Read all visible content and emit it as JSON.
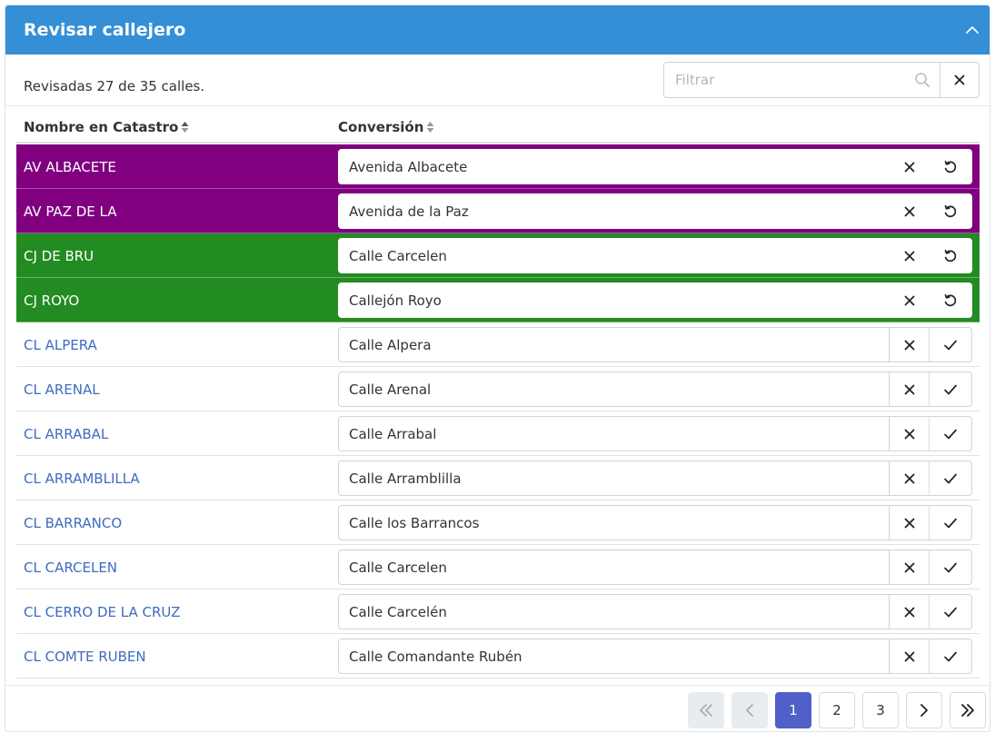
{
  "panel": {
    "title": "Revisar callejero",
    "header_color": "#348fd6"
  },
  "toolbar": {
    "summary": "Revisadas 27 de 35 calles.",
    "filter_placeholder": "Filtrar"
  },
  "table": {
    "headers": {
      "name": "Nombre en Catastro",
      "conversion": "Conversión"
    },
    "rows": [
      {
        "name": "AV ALBACETE",
        "conversion": "Avenida Albacete",
        "status": "purple",
        "action": "undo"
      },
      {
        "name": "AV PAZ DE LA",
        "conversion": "Avenida de la Paz",
        "status": "purple",
        "action": "undo"
      },
      {
        "name": "CJ DE BRU",
        "conversion": "Calle Carcelen",
        "status": "green",
        "action": "undo"
      },
      {
        "name": "CJ ROYO",
        "conversion": "Callejón Royo",
        "status": "green",
        "action": "undo"
      },
      {
        "name": "CL ALPERA",
        "conversion": "Calle Alpera",
        "status": "pending",
        "action": "confirm"
      },
      {
        "name": "CL ARENAL",
        "conversion": "Calle Arenal",
        "status": "pending",
        "action": "confirm"
      },
      {
        "name": "CL ARRABAL",
        "conversion": "Calle Arrabal",
        "status": "pending",
        "action": "confirm"
      },
      {
        "name": "CL ARRAMBLILLA",
        "conversion": "Calle Arramblilla",
        "status": "pending",
        "action": "confirm"
      },
      {
        "name": "CL BARRANCO",
        "conversion": "Calle los Barrancos",
        "status": "pending",
        "action": "confirm"
      },
      {
        "name": "CL CARCELEN",
        "conversion": "Calle Carcelen",
        "status": "pending",
        "action": "confirm"
      },
      {
        "name": "CL CERRO DE LA CRUZ",
        "conversion": "Calle Carcelén",
        "status": "pending",
        "action": "confirm"
      },
      {
        "name": "CL COMTE RUBEN",
        "conversion": "Calle Comandante Rubén",
        "status": "pending",
        "action": "confirm"
      }
    ]
  },
  "pagination": {
    "pages": [
      "1",
      "2",
      "3"
    ],
    "current": "1"
  },
  "colors": {
    "purple_row": "#800080",
    "green_row": "#228b22",
    "link": "#3f6cc0",
    "active_page": "#5060c8"
  },
  "icons": {
    "collapse": "chevron-up-icon",
    "search": "search-icon",
    "clear": "close-icon",
    "undo": "undo-icon",
    "confirm": "check-icon"
  }
}
